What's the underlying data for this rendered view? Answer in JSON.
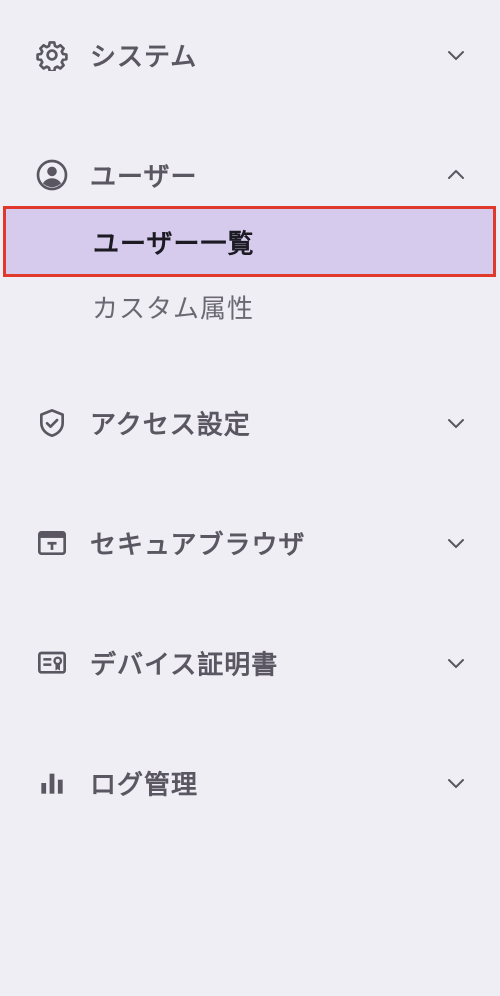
{
  "sidebar": {
    "sections": [
      {
        "label": "システム",
        "icon": "gear-icon",
        "expanded": false
      },
      {
        "label": "ユーザー",
        "icon": "user-circle-icon",
        "expanded": true,
        "children": [
          {
            "label": "ユーザー一覧",
            "active": true
          },
          {
            "label": "カスタム属性",
            "active": false
          }
        ]
      },
      {
        "label": "アクセス設定",
        "icon": "shield-check-icon",
        "expanded": false
      },
      {
        "label": "セキュアブラウザ",
        "icon": "browser-window-icon",
        "expanded": false
      },
      {
        "label": "デバイス証明書",
        "icon": "certificate-icon",
        "expanded": false
      },
      {
        "label": "ログ管理",
        "icon": "bar-chart-icon",
        "expanded": false
      }
    ]
  },
  "colors": {
    "background": "#efeef4",
    "active_bg": "#d6cbec",
    "highlight_border": "#e0382b",
    "text": "#5a5762"
  }
}
